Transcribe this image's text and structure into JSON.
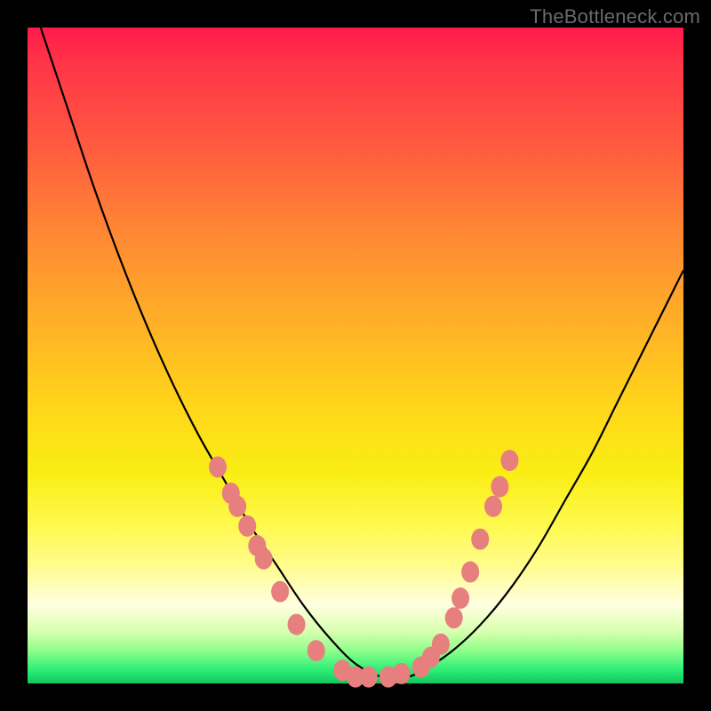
{
  "watermark": "TheBottleneck.com",
  "colors": {
    "frame": "#000000",
    "curve": "#000000",
    "marker_fill": "#e77f7f",
    "marker_stroke": "#c95a5a"
  },
  "chart_data": {
    "type": "line",
    "title": "",
    "xlabel": "",
    "ylabel": "",
    "xlim": [
      0,
      100
    ],
    "ylim": [
      0,
      100
    ],
    "grid": false,
    "legend": false,
    "series": [
      {
        "name": "bottleneck-curve",
        "x": [
          2,
          6,
          10,
          14,
          18,
          22,
          26,
          30,
          34,
          38,
          42,
          46,
          50,
          54,
          58,
          62,
          66,
          70,
          74,
          78,
          82,
          86,
          90,
          94,
          98,
          100
        ],
        "y": [
          100,
          88,
          76,
          65,
          55,
          46,
          38,
          31,
          24,
          18,
          12,
          7,
          3,
          1,
          1,
          3,
          6,
          10,
          15,
          21,
          28,
          35,
          43,
          51,
          59,
          63
        ]
      }
    ],
    "markers": {
      "name": "highlighted-points",
      "points": [
        {
          "x": 29,
          "y": 33
        },
        {
          "x": 31,
          "y": 29
        },
        {
          "x": 32,
          "y": 27
        },
        {
          "x": 33.5,
          "y": 24
        },
        {
          "x": 35,
          "y": 21
        },
        {
          "x": 36,
          "y": 19
        },
        {
          "x": 38.5,
          "y": 14
        },
        {
          "x": 41,
          "y": 9
        },
        {
          "x": 44,
          "y": 5
        },
        {
          "x": 48,
          "y": 2
        },
        {
          "x": 50,
          "y": 1
        },
        {
          "x": 52,
          "y": 1
        },
        {
          "x": 55,
          "y": 1
        },
        {
          "x": 57,
          "y": 1.5
        },
        {
          "x": 60,
          "y": 2.5
        },
        {
          "x": 61.5,
          "y": 4
        },
        {
          "x": 63,
          "y": 6
        },
        {
          "x": 65,
          "y": 10
        },
        {
          "x": 66,
          "y": 13
        },
        {
          "x": 67.5,
          "y": 17
        },
        {
          "x": 69,
          "y": 22
        },
        {
          "x": 71,
          "y": 27
        },
        {
          "x": 72,
          "y": 30
        },
        {
          "x": 73.5,
          "y": 34
        }
      ]
    }
  }
}
